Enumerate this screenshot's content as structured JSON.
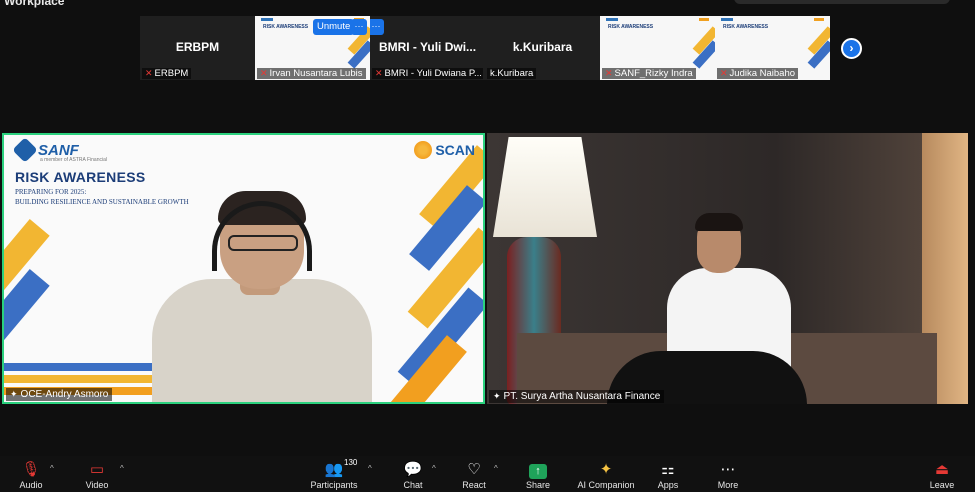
{
  "window": {
    "title": "Workplace"
  },
  "thumbnails": [
    {
      "type": "avatar",
      "big_name": "ERBPM",
      "label": "ERBPM",
      "muted": true
    },
    {
      "type": "slide",
      "label": "Irvan Nusantara Lubis",
      "muted": true,
      "has_menu": true,
      "unmute_label": "Unmute"
    },
    {
      "type": "avatar",
      "big_name": "BMRI - Yuli Dwi...",
      "label": "BMRI - Yuli Dwiana P...",
      "muted": true,
      "has_menu": true
    },
    {
      "type": "avatar",
      "big_name": "k.Kuribara",
      "label": "k.Kuribara",
      "muted": false
    },
    {
      "type": "slide",
      "label": "SANF_Rizky Indra",
      "muted": true
    },
    {
      "type": "slide",
      "label": "Judika Naibaho",
      "muted": true
    }
  ],
  "thumb_menu_label": "···",
  "next_page_icon": "chevron-right-icon",
  "main": {
    "left": {
      "label": "OCE-Andry Asmoro",
      "speaking": true,
      "slide": {
        "brand_left": "SANF",
        "brand_left_sub": "a member of ASTRA Financial",
        "brand_right": "SCAN",
        "title": "RISK AWARENESS",
        "subtitle_1": "PREPARING FOR 2025:",
        "subtitle_2": "BUILDING RESILIENCE AND SUSTAINABLE GROWTH"
      }
    },
    "right": {
      "label": "PT. Surya Artha Nusantara Finance"
    }
  },
  "toolbar": {
    "audio": "Audio",
    "video": "Video",
    "participants": "Participants",
    "participants_count": "130",
    "chat": "Chat",
    "react": "React",
    "share": "Share",
    "ai_companion": "AI Companion",
    "apps": "Apps",
    "more": "More",
    "leave": "Leave"
  },
  "colors": {
    "accent_blue": "#1a73e8",
    "active_speaker": "#2bd17e",
    "mute_red": "#e53935",
    "share_green": "#1fa35a",
    "slide_navy": "#1c3d78",
    "slide_orange": "#f29f1f"
  }
}
